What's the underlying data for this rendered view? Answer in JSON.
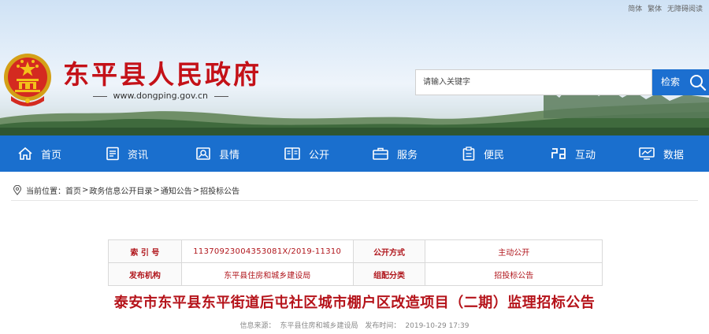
{
  "header": {
    "lang_links": [
      "简体",
      "繁体",
      "无障碍阅读"
    ],
    "site_title": "东平县人民政府",
    "site_url": "www.dongping.gov.cn",
    "search": {
      "placeholder": "请输入关键字",
      "button_label": "检索"
    }
  },
  "nav": {
    "items": [
      {
        "label": "首页",
        "icon": "home-icon"
      },
      {
        "label": "资讯",
        "icon": "news-icon"
      },
      {
        "label": "县情",
        "icon": "county-info-icon"
      },
      {
        "label": "公开",
        "icon": "open-book-icon"
      },
      {
        "label": "服务",
        "icon": "briefcase-icon"
      },
      {
        "label": "便民",
        "icon": "clipboard-icon"
      },
      {
        "label": "互动",
        "icon": "interaction-icon"
      },
      {
        "label": "数据",
        "icon": "chart-monitor-icon"
      }
    ]
  },
  "breadcrumb": {
    "prefix": "当前位置：",
    "items": [
      "首页",
      "政务信息公开目录",
      "通知公告",
      "招投标公告"
    ],
    "separator": ">"
  },
  "meta_table": {
    "rows": [
      {
        "k1": "索 引 号",
        "v1": "11370923004353081X/2019-11310",
        "k2": "公开方式",
        "v2": "主动公开"
      },
      {
        "k1": "发布机构",
        "v1": "东平县住房和城乡建设局",
        "k2": "组配分类",
        "v2": "招投标公告"
      }
    ]
  },
  "article": {
    "title": "泰安市东平县东平街道后屯社区城市棚户区改造项目（二期）监理招标公告",
    "source_label": "信息来源：",
    "source": "东平县住房和城乡建设局",
    "time_label": "发布时间：",
    "time": "2019-10-29 17:39"
  },
  "colors": {
    "brand_red": "#c41118",
    "nav_blue": "#1a6fce",
    "search_blue": "#1c6fd0"
  }
}
